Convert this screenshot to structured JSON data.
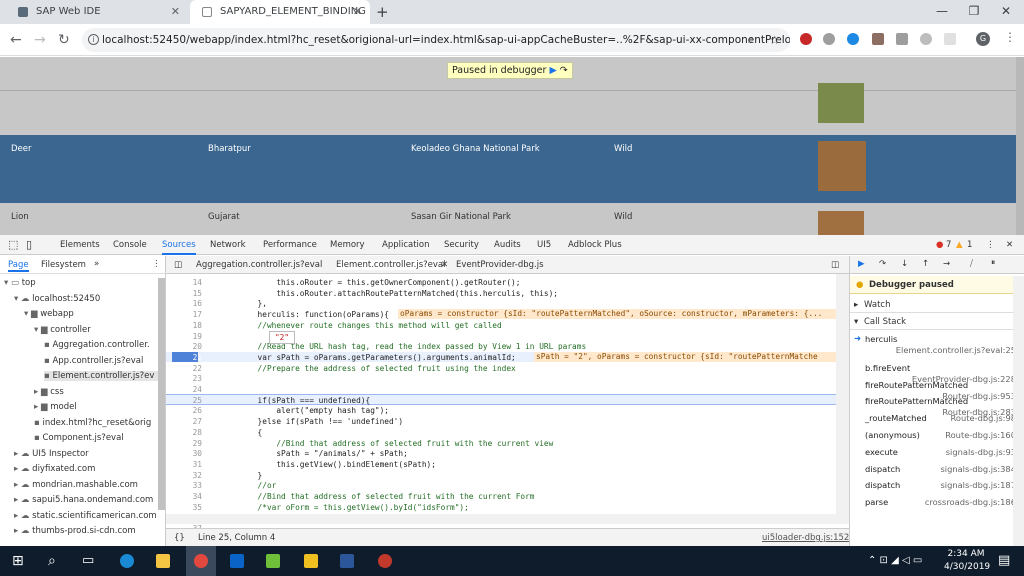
{
  "browser": {
    "tabs": [
      {
        "title": "SAP Web IDE"
      },
      {
        "title": "SAPYARD_ELEMENT_BINDING"
      }
    ],
    "new_tab": "+",
    "url": "localhost:52450/webapp/index.html?hc_reset&origional-url=index.html&sap-ui-appCacheBuster=..%2F&sap-ui-xx-componentPreload...",
    "avatar": "G"
  },
  "app": {
    "paused": "Paused in debugger",
    "rows": [
      {
        "animal": "Deer",
        "place": "Bharatpur",
        "park": "Keoladeo Ghana National Park",
        "type": "Wild"
      },
      {
        "animal": "Lion",
        "place": "Gujarat",
        "park": "Sasan Gir National Park",
        "type": "Wild"
      }
    ]
  },
  "devtools": {
    "tabs": [
      "Elements",
      "Console",
      "Sources",
      "Network",
      "Performance",
      "Memory",
      "Application",
      "Security",
      "Audits",
      "UI5",
      "Adblock Plus"
    ],
    "errors": "7",
    "warnings": "1",
    "nav_tabs": [
      "Page",
      "Filesystem"
    ],
    "tree": [
      "top",
      "localhost:52450",
      "webapp",
      "controller",
      "Aggregation.controller.",
      "App.controller.js?eval",
      "Element.controller.js?ev",
      "css",
      "model",
      "index.html?hc_reset&orig",
      "Component.js?eval",
      "UI5 Inspector",
      "diyfixated.com",
      "mondrian.mashable.com",
      "sapui5.hana.ondemand.com",
      "static.scientificamerican.com",
      "thumbs-prod.si-cdn.com"
    ],
    "file_tabs": [
      "Aggregation.controller.js?eval",
      "Element.controller.js?eval",
      "EventProvider-dbg.js"
    ],
    "lines": [
      {
        "n": "14",
        "t": "            this.oRouter = this.getOwnerComponent().getRouter();"
      },
      {
        "n": "15",
        "t": "            this.oRouter.attachRoutePatternMatched(this.herculis, this);"
      },
      {
        "n": "16",
        "t": "        },"
      },
      {
        "n": "17",
        "t": "        herculis: function(oParams){"
      },
      {
        "n": "18",
        "t": "        //whenever route changes this method will get called"
      },
      {
        "n": "19",
        "t": ""
      },
      {
        "n": "20",
        "t": "        //Read the URL hash tag, read the index passed by View 1 in URL params"
      },
      {
        "n": "21",
        "t": "        var sPath = oParams.getParameters().arguments.animalId;"
      },
      {
        "n": "22",
        "t": "        //Prepare the address of selected fruit using the index"
      },
      {
        "n": "23",
        "t": ""
      },
      {
        "n": "24",
        "t": ""
      },
      {
        "n": "25",
        "t": "        if(sPath === undefined){"
      },
      {
        "n": "26",
        "t": "            alert(\"empty hash tag\");"
      },
      {
        "n": "27",
        "t": "        }else if(sPath !== 'undefined')"
      },
      {
        "n": "28",
        "t": "        {"
      },
      {
        "n": "29",
        "t": "            //Bind that address of selected fruit with the current view"
      },
      {
        "n": "30",
        "t": "            sPath = \"/animals/\" + sPath;"
      },
      {
        "n": "31",
        "t": "            this.getView().bindElement(sPath);"
      },
      {
        "n": "32",
        "t": "        }"
      },
      {
        "n": "33",
        "t": "        //or"
      },
      {
        "n": "34",
        "t": "        //Bind that address of selected fruit with the current Form"
      },
      {
        "n": "35",
        "t": "        /*var oForm = this.getView().byId(\"idsForm\");"
      },
      {
        "n": "36",
        "t": ""
      },
      {
        "n": "37",
        "t": ""
      }
    ],
    "inline1": "oParams = constructor {sId: \"routePatternMatched\", oSource: constructor, mParameters: {...",
    "inline2": "sPath = \"2\", oParams = constructor {sId: \"routePatternMatche",
    "tooltip": "\"2\"",
    "status": "Line 25, Column 4",
    "status_link": "ui5loader-dbg.js:1522",
    "debug_paused": "Debugger paused",
    "watch": "Watch",
    "call_stack": "Call Stack",
    "stack": [
      {
        "fn": "herculis",
        "loc": "Element.controller.js?eval:25"
      },
      {
        "fn": "b.fireEvent",
        "loc": "EventProvider-dbg.js:228"
      },
      {
        "fn": "fireRoutePatternMatched",
        "loc": "Router-dbg.js:953"
      },
      {
        "fn": "fireRoutePatternMatched",
        "loc": "Router-dbg.js:283"
      },
      {
        "fn": "_routeMatched",
        "loc": "Route-dbg.js:98"
      },
      {
        "fn": "(anonymous)",
        "loc": "Route-dbg.js:160"
      },
      {
        "fn": "execute",
        "loc": "signals-dbg.js:93"
      },
      {
        "fn": "dispatch",
        "loc": "signals-dbg.js:384"
      },
      {
        "fn": "dispatch",
        "loc": "signals-dbg.js:187"
      },
      {
        "fn": "parse",
        "loc": "crossroads-dbg.js:186"
      }
    ]
  },
  "taskbar": {
    "time": "2:34 AM",
    "date": "4/30/2019"
  }
}
